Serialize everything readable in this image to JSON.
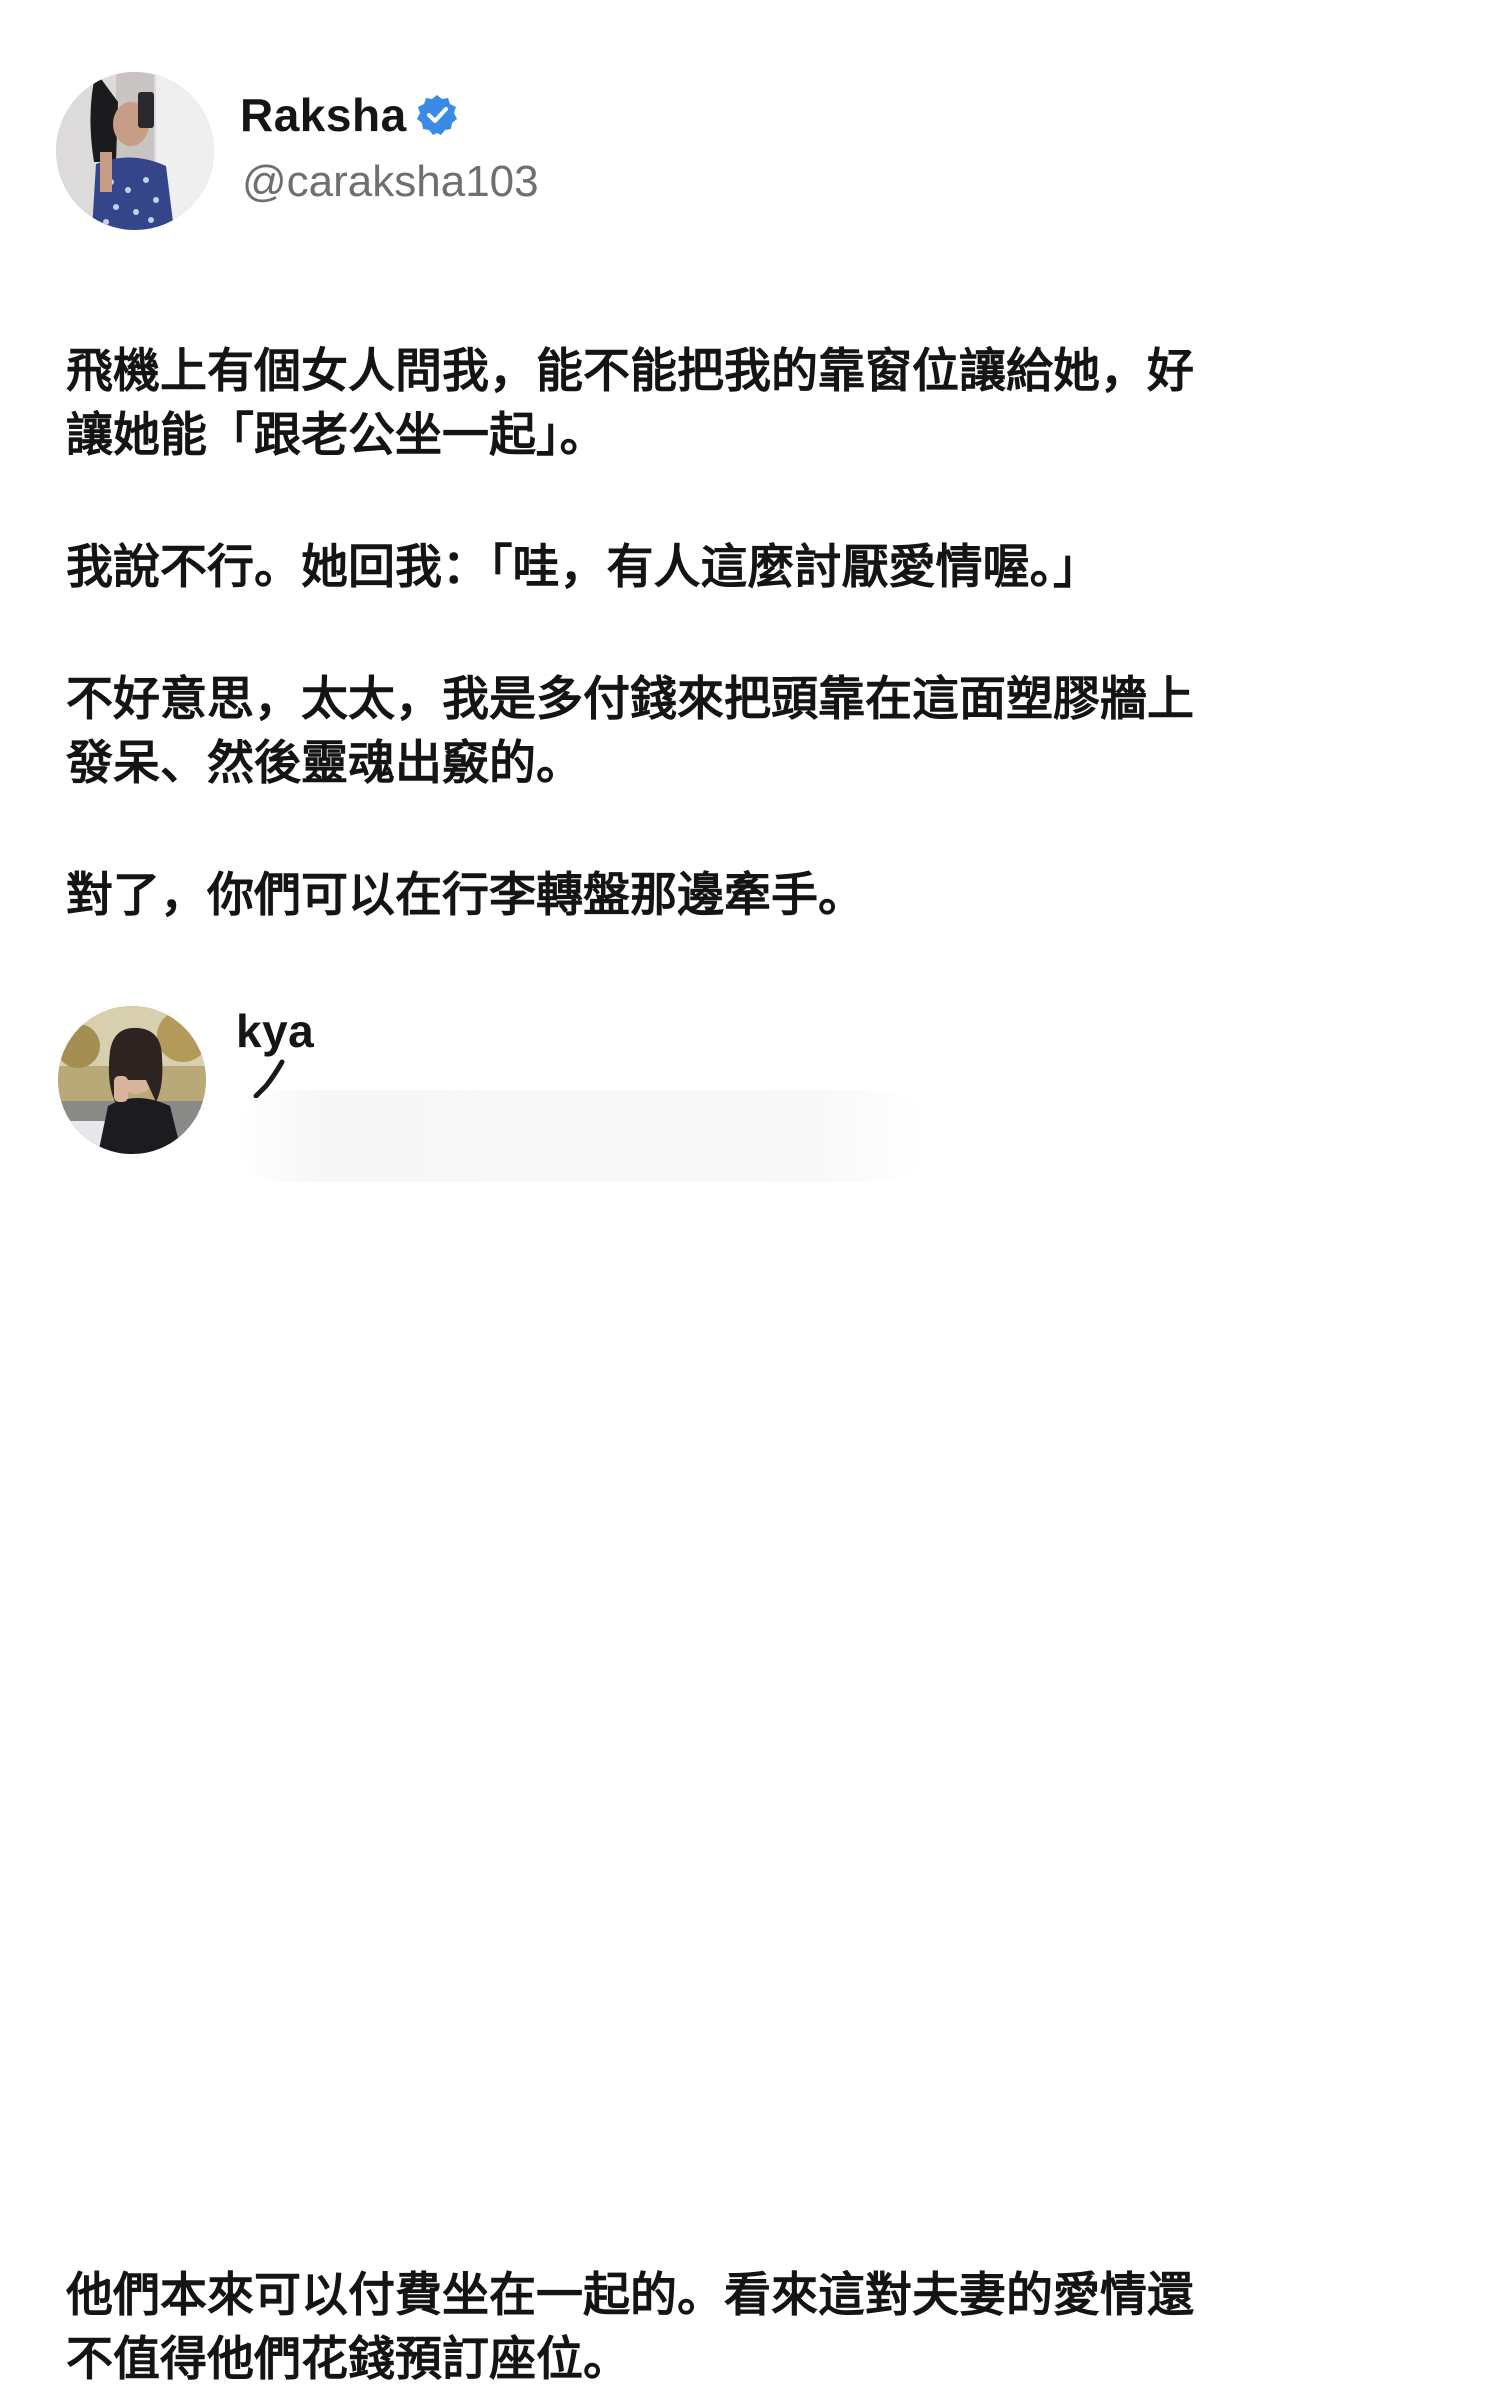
{
  "post_1": {
    "author": {
      "display_name": "Raksha",
      "handle": "@caraksha103",
      "verified": true,
      "avatar_icon": "profile-photo"
    },
    "paragraphs": [
      "飛機上有個女人問我，能不能把我的靠窗位讓給她，好\n讓她能「跟老公坐一起」。",
      "我說不行。她回我：「哇，有人這麼討厭愛情喔。」",
      "不好意思，太太，我是多付錢來把頭靠在這面塑膠牆上\n發呆、然後靈魂出竅的。",
      "對了，你們可以在行李轉盤那邊牽手。"
    ]
  },
  "post_2": {
    "author": {
      "display_name": "kya",
      "avatar_icon": "profile-photo"
    },
    "paragraphs": [
      "他們本來可以付費坐在一起的。看來這對夫妻的愛情還\n不值得他們花錢預訂座位。"
    ]
  },
  "colors": {
    "verified_blue": "#3b8be6",
    "handle_gray": "#6f6f6f",
    "text_dark": "#141414"
  }
}
